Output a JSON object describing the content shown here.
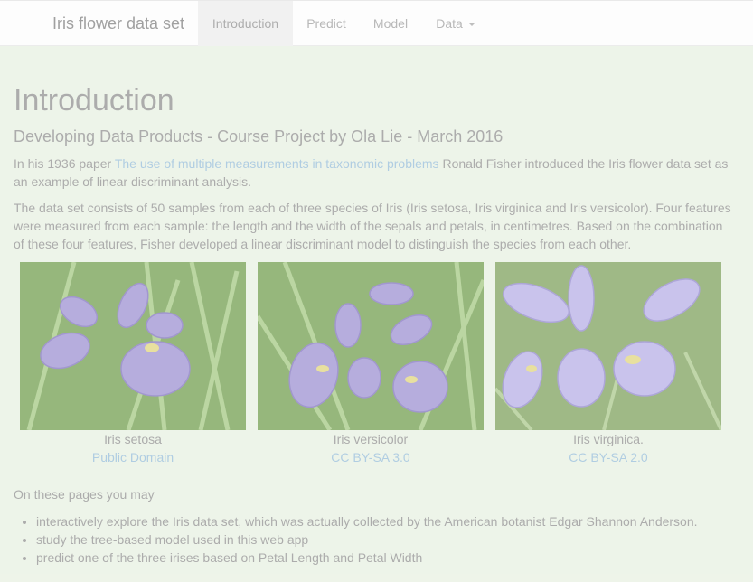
{
  "navbar": {
    "brand": "Iris flower data set",
    "items": [
      {
        "label": "Introduction",
        "active": true
      },
      {
        "label": "Predict",
        "active": false
      },
      {
        "label": "Model",
        "active": false
      },
      {
        "label": "Data",
        "active": false,
        "dropdown": true
      }
    ]
  },
  "page": {
    "title": "Introduction",
    "subtitle": "Developing Data Products - Course Project by Ola Lie - March 2016",
    "para1": {
      "before": "In his 1936 paper ",
      "link": "The use of multiple measurements in taxonomic problems",
      "after": " Ronald Fisher introduced the Iris flower data set as an example of linear discriminant analysis."
    },
    "para2": "The data set consists of 50 samples from each of three species of Iris (Iris setosa, Iris virginica and Iris versicolor). Four features were measured from each sample: the length and the width of the sepals and petals, in centimetres. Based on the combination of these four features, Fisher developed a linear discriminant model to distinguish the species from each other."
  },
  "figures": [
    {
      "caption": "Iris setosa",
      "license": "Public Domain"
    },
    {
      "caption": "Iris versicolor",
      "license": "CC BY-SA 3.0"
    },
    {
      "caption": "Iris virginica.",
      "license": "CC BY-SA 2.0"
    }
  ],
  "outro": {
    "lead": "On these pages you may",
    "items": [
      "interactively explore the Iris data set, which was actually collected by the American botanist Edgar Shannon Anderson.",
      "study the tree-based model used in this web app",
      "predict one of the three irises based on Petal Length and Petal Width"
    ]
  },
  "colors": {
    "background": "#eaf2e4",
    "link": "#9fc3dc",
    "petal": "#a79bd6",
    "leaf": "#7fa860"
  }
}
